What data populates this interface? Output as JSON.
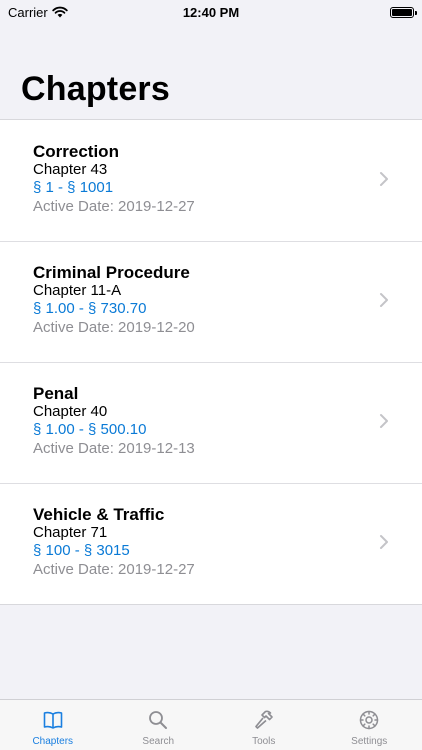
{
  "status_bar": {
    "carrier": "Carrier",
    "time": "12:40 PM"
  },
  "page": {
    "title": "Chapters"
  },
  "chapters": [
    {
      "title": "Correction",
      "chapter": "Chapter 43",
      "range": "§ 1 - § 1001",
      "active_date": "Active Date: 2019-12-27"
    },
    {
      "title": "Criminal Procedure",
      "chapter": "Chapter 11-A",
      "range": "§ 1.00 - § 730.70",
      "active_date": "Active Date: 2019-12-20"
    },
    {
      "title": "Penal",
      "chapter": "Chapter 40",
      "range": "§ 1.00 - § 500.10",
      "active_date": "Active Date: 2019-12-13"
    },
    {
      "title": "Vehicle & Traffic",
      "chapter": "Chapter 71",
      "range": "§ 100 - § 3015",
      "active_date": "Active Date: 2019-12-27"
    }
  ],
  "tab_bar": {
    "items": [
      {
        "label": "Chapters",
        "icon": "book-icon",
        "active": true
      },
      {
        "label": "Search",
        "icon": "magnifier-icon",
        "active": false
      },
      {
        "label": "Tools",
        "icon": "hammer-icon",
        "active": false
      },
      {
        "label": "Settings",
        "icon": "gear-icon",
        "active": false
      }
    ]
  },
  "colors": {
    "accent": "#1a7fe0",
    "range_text": "#0a7ad6",
    "secondary_text": "#8e8e93",
    "background": "#f2f2f7"
  }
}
